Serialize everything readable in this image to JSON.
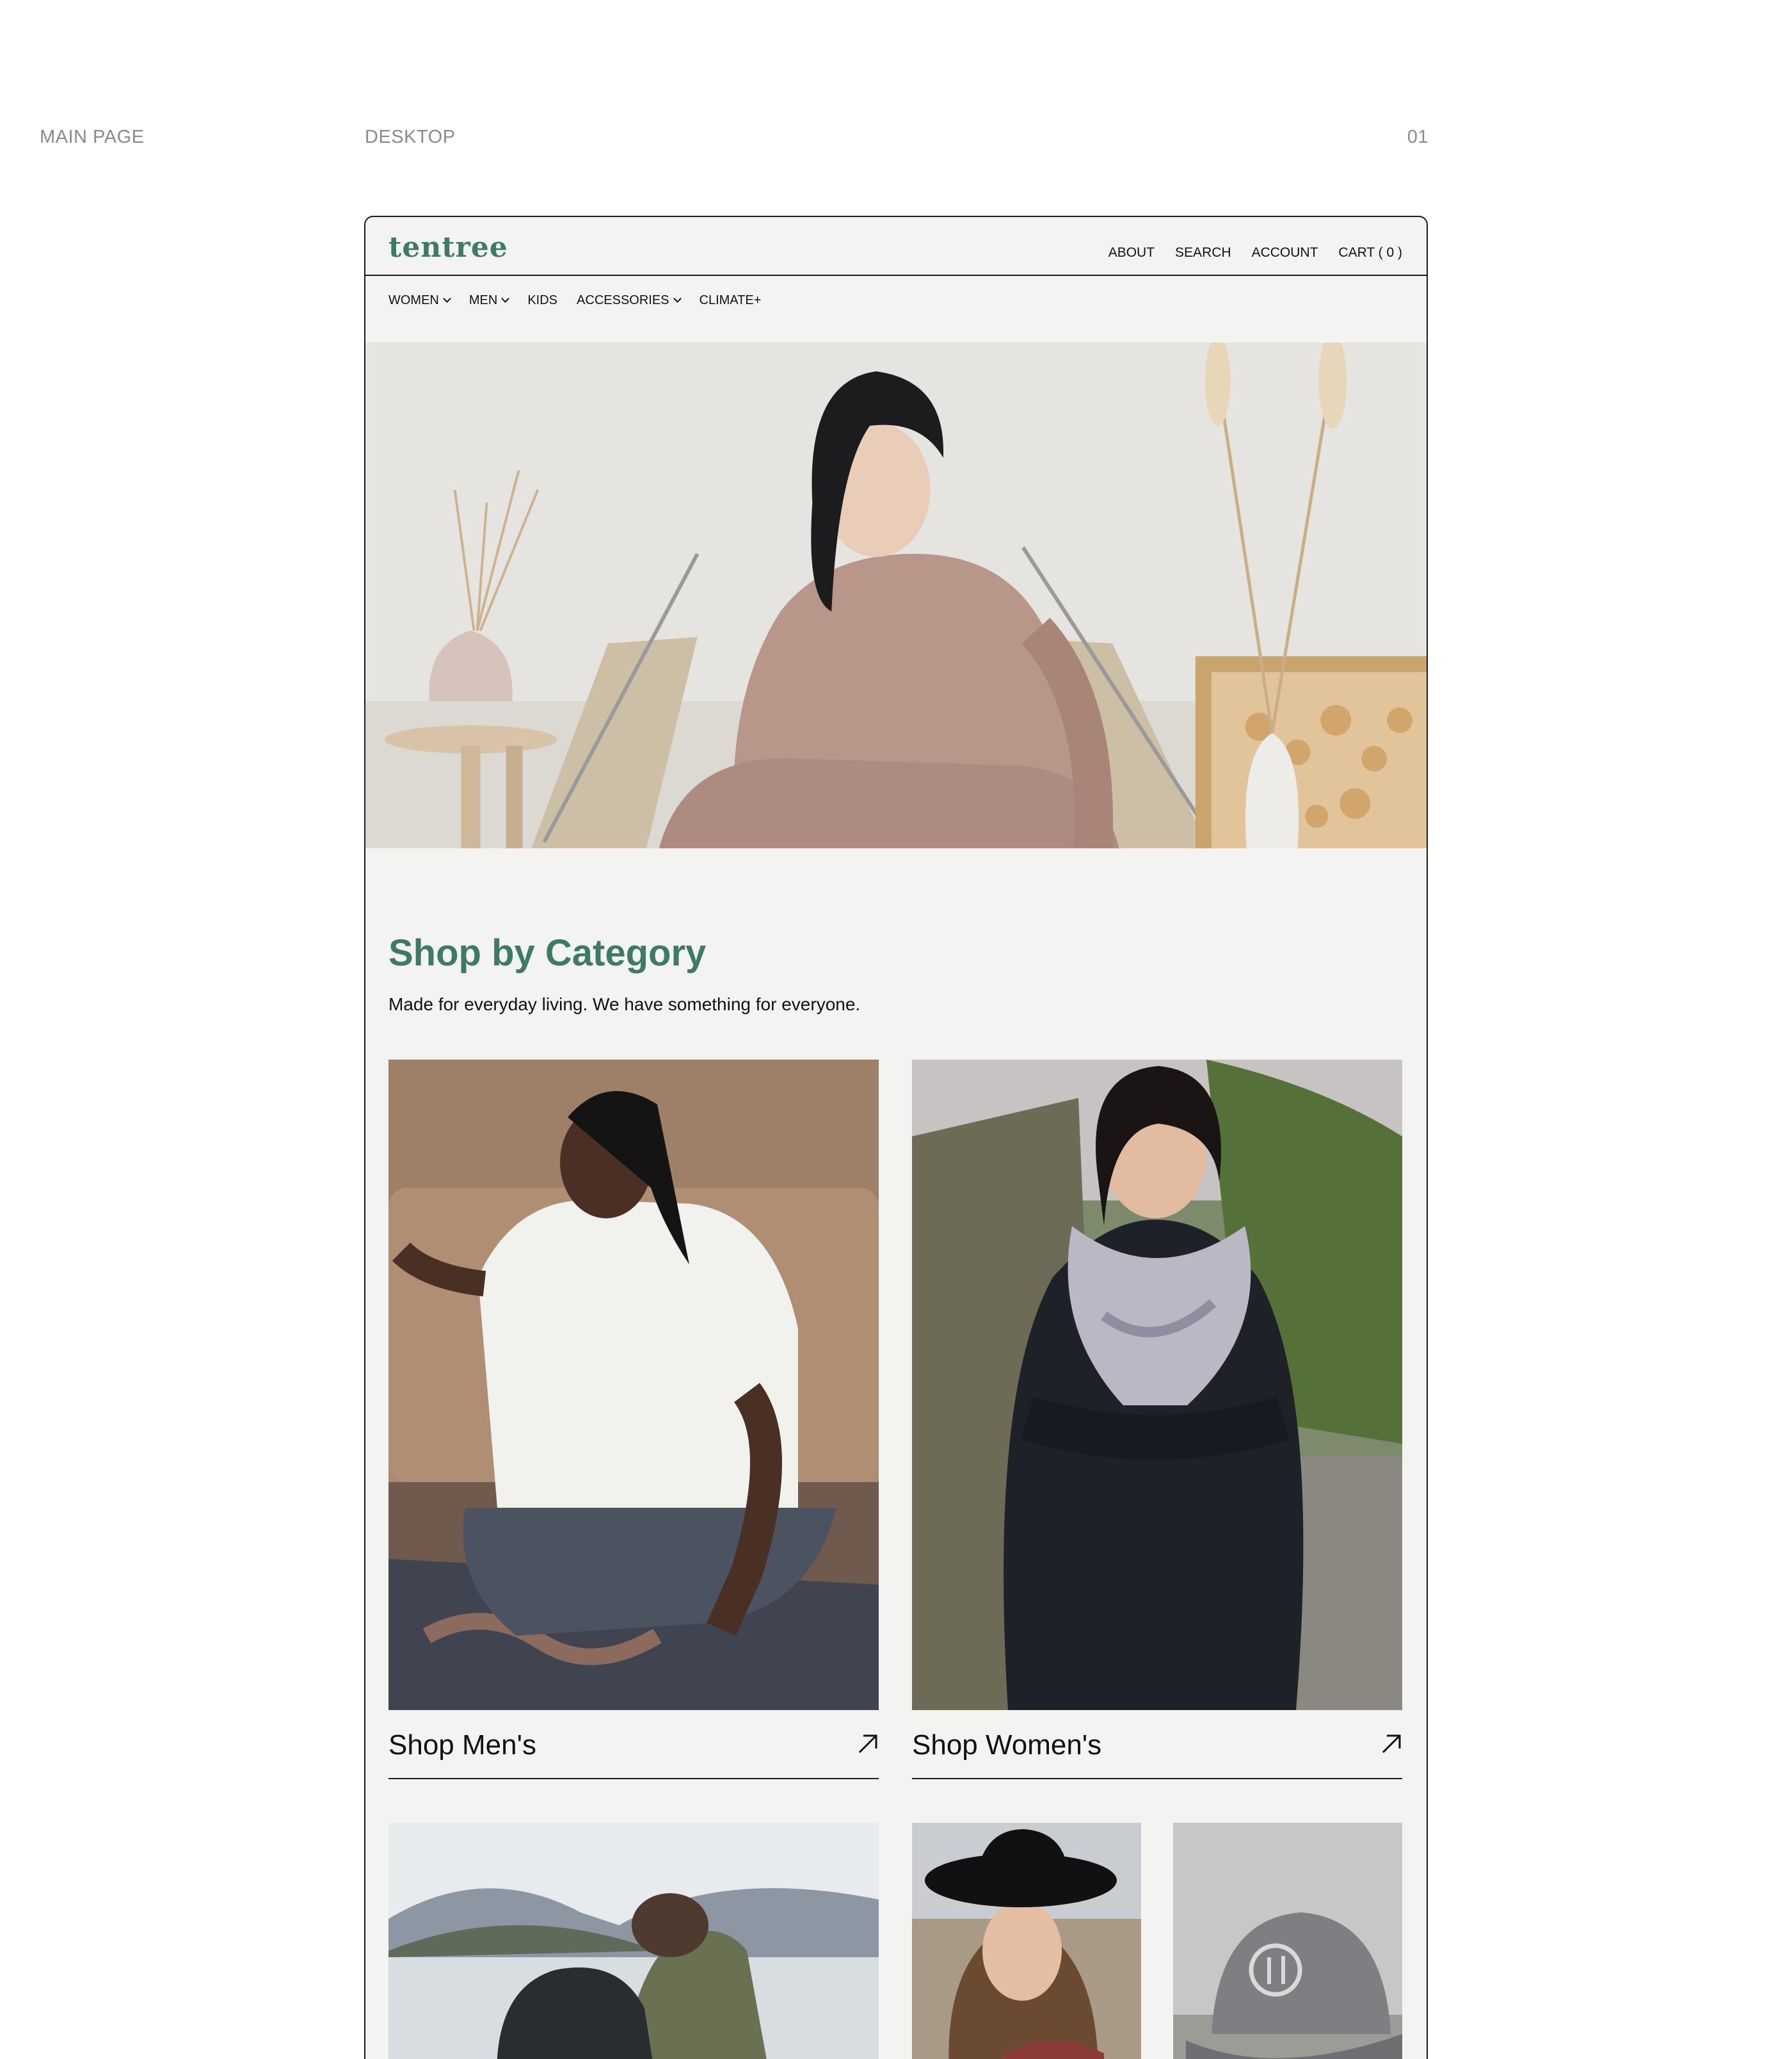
{
  "meta": {
    "section": "MAIN PAGE",
    "device": "DESKTOP",
    "page_number": "01"
  },
  "brand": {
    "logo": "tentree",
    "accent": "#3f7a63"
  },
  "utility_nav": [
    "ABOUT",
    "SEARCH",
    "ACCOUNT",
    "CART ( 0 )"
  ],
  "category_nav": [
    {
      "label": "WOMEN",
      "dropdown": true
    },
    {
      "label": "MEN",
      "dropdown": true
    },
    {
      "label": "KIDS",
      "dropdown": false
    },
    {
      "label": "ACCESSORIES",
      "dropdown": true
    },
    {
      "label": "CLIMATE+",
      "dropdown": false
    }
  ],
  "shop": {
    "title": "Shop by Category",
    "subtitle": "Made for everyday living. We have something for everyone.",
    "cards": [
      {
        "label": "Shop Men's",
        "icon": "arrow-up-right-icon"
      },
      {
        "label": "Shop Women's",
        "icon": "arrow-up-right-icon"
      }
    ]
  }
}
